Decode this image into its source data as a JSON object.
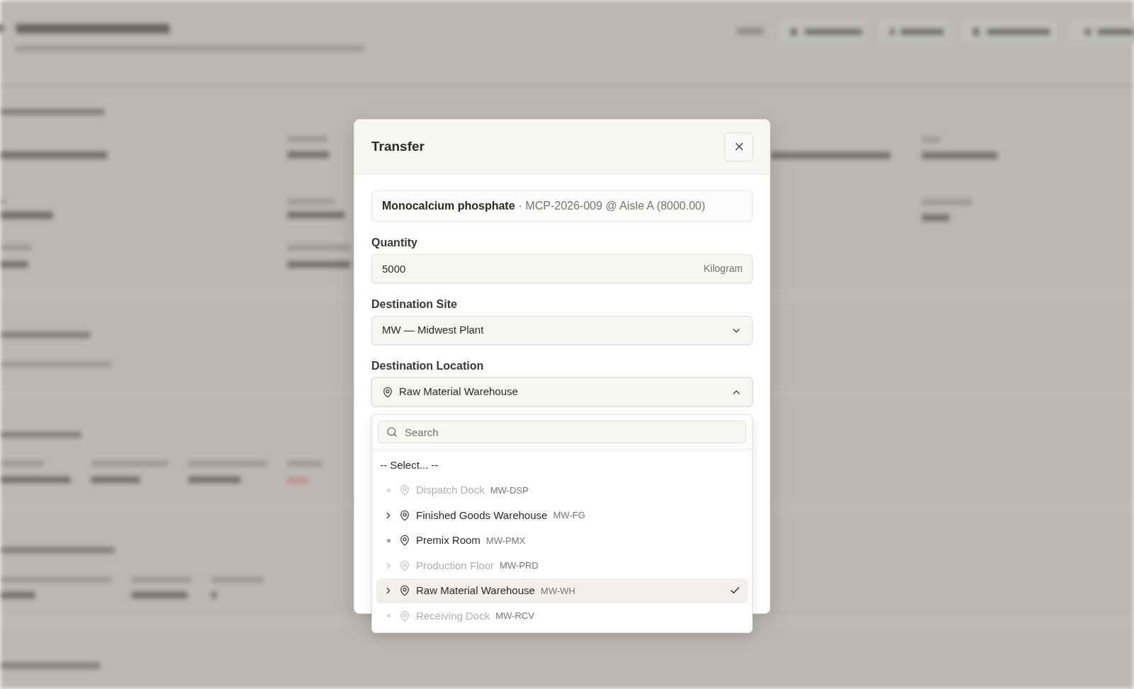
{
  "dialog": {
    "title": "Transfer",
    "source": {
      "name": "Monocalcium phosphate",
      "detail": "· MCP-2026-009 @ Aisle A (8000.00)"
    },
    "fields": [
      {
        "kind": "number",
        "label": "Quantity",
        "value": "5000",
        "unit": "Kilogram"
      },
      {
        "kind": "select",
        "label": "Destination Site",
        "value": "MW — Midwest Plant",
        "open": false
      },
      {
        "kind": "location",
        "label": "Destination Location",
        "value": "Raw Material Warehouse",
        "open": true,
        "menu": {
          "search": {
            "placeholder": "Search"
          },
          "options": [
            {
              "kind": "placeholder",
              "name": "-- Select... --",
              "selected": false,
              "disabled": false
            },
            {
              "kind": "leaf",
              "name": "Dispatch Dock",
              "code": "MW-DSP",
              "selected": false,
              "disabled": true
            },
            {
              "kind": "branch",
              "name": "Finished Goods Warehouse",
              "code": "MW-FG",
              "selected": false,
              "disabled": false
            },
            {
              "kind": "leaf",
              "name": "Premix Room",
              "code": "MW-PMX",
              "selected": false,
              "disabled": false
            },
            {
              "kind": "branch",
              "name": "Production Floor",
              "code": "MW-PRD",
              "selected": false,
              "disabled": true
            },
            {
              "kind": "branch",
              "name": "Raw Material Warehouse",
              "code": "MW-WH",
              "selected": true,
              "disabled": false
            },
            {
              "kind": "leaf",
              "name": "Receiving Dock",
              "code": "MW-RCV",
              "selected": false,
              "disabled": true
            }
          ]
        }
      }
    ]
  }
}
